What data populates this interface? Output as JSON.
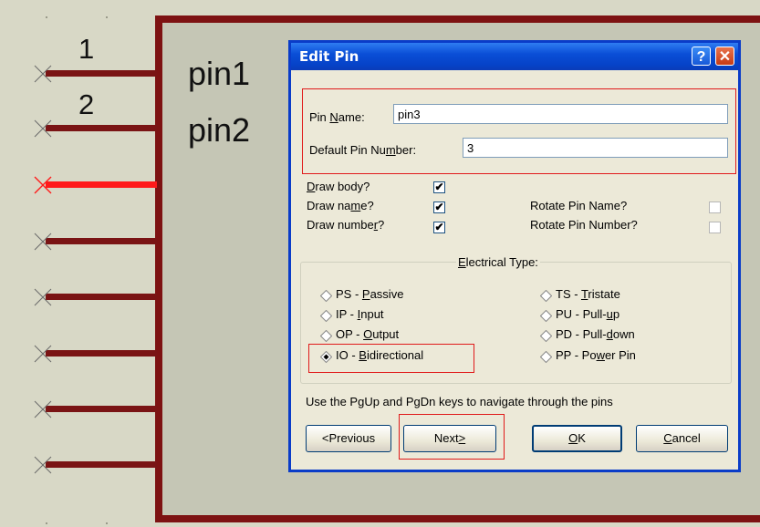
{
  "schematic": {
    "pin_numbers": [
      "1",
      "2"
    ],
    "pin_names": [
      "pin1",
      "pin2"
    ],
    "colors": {
      "pin": "#7a1414",
      "selected_pin": "#ff1a1a",
      "body_border": "#7d1212"
    }
  },
  "dialog": {
    "title": "Edit Pin",
    "help_glyph": "?",
    "close_glyph": "✕",
    "pin_name": {
      "label_pre": "Pin ",
      "label_key": "N",
      "label_post": "ame:",
      "value": "pin3"
    },
    "pin_number": {
      "label_pre": "Default Pin Nu",
      "label_key": "m",
      "label_post": "ber:",
      "value": "3"
    },
    "draw_body": {
      "label_key": "D",
      "label_post": "raw body?",
      "checked": true
    },
    "draw_name": {
      "label_pre": "Draw na",
      "label_key": "m",
      "label_post": "e?",
      "checked": true
    },
    "draw_number": {
      "label_pre": "Draw numbe",
      "label_key": "r",
      "label_post": "?",
      "checked": true
    },
    "rotate_name": {
      "label": "Rotate Pin Name?",
      "checked": false
    },
    "rotate_number": {
      "label": "Rotate Pin Number?",
      "checked": false
    },
    "electrical_type": {
      "title_key": "E",
      "title_post": "lectrical Type:",
      "options": [
        {
          "pre": "PS - ",
          "key": "P",
          "post": "assive",
          "selected": false
        },
        {
          "pre": "IP - ",
          "key": "I",
          "post": "nput",
          "selected": false
        },
        {
          "pre": "OP - ",
          "key": "O",
          "post": "utput",
          "selected": false
        },
        {
          "pre": "IO - ",
          "key": "B",
          "post": "idirectional",
          "selected": true
        },
        {
          "pre": "TS - ",
          "key": "T",
          "post": "ristate",
          "selected": false
        },
        {
          "pre": "PU - Pull-",
          "key": "u",
          "post": "p",
          "selected": false
        },
        {
          "pre": "PD - Pull-",
          "key": "d",
          "post": "own",
          "selected": false
        },
        {
          "pre": "PP - Po",
          "key": "w",
          "post": "er Pin",
          "selected": false
        }
      ]
    },
    "hint": "Use the PgUp and PgDn keys to navigate through the pins",
    "buttons": {
      "previous": "<Previous",
      "next_pre": "Next",
      "next_key": ">",
      "ok_key": "O",
      "ok_post": "K",
      "cancel_key": "C",
      "cancel_post": "ancel"
    }
  }
}
